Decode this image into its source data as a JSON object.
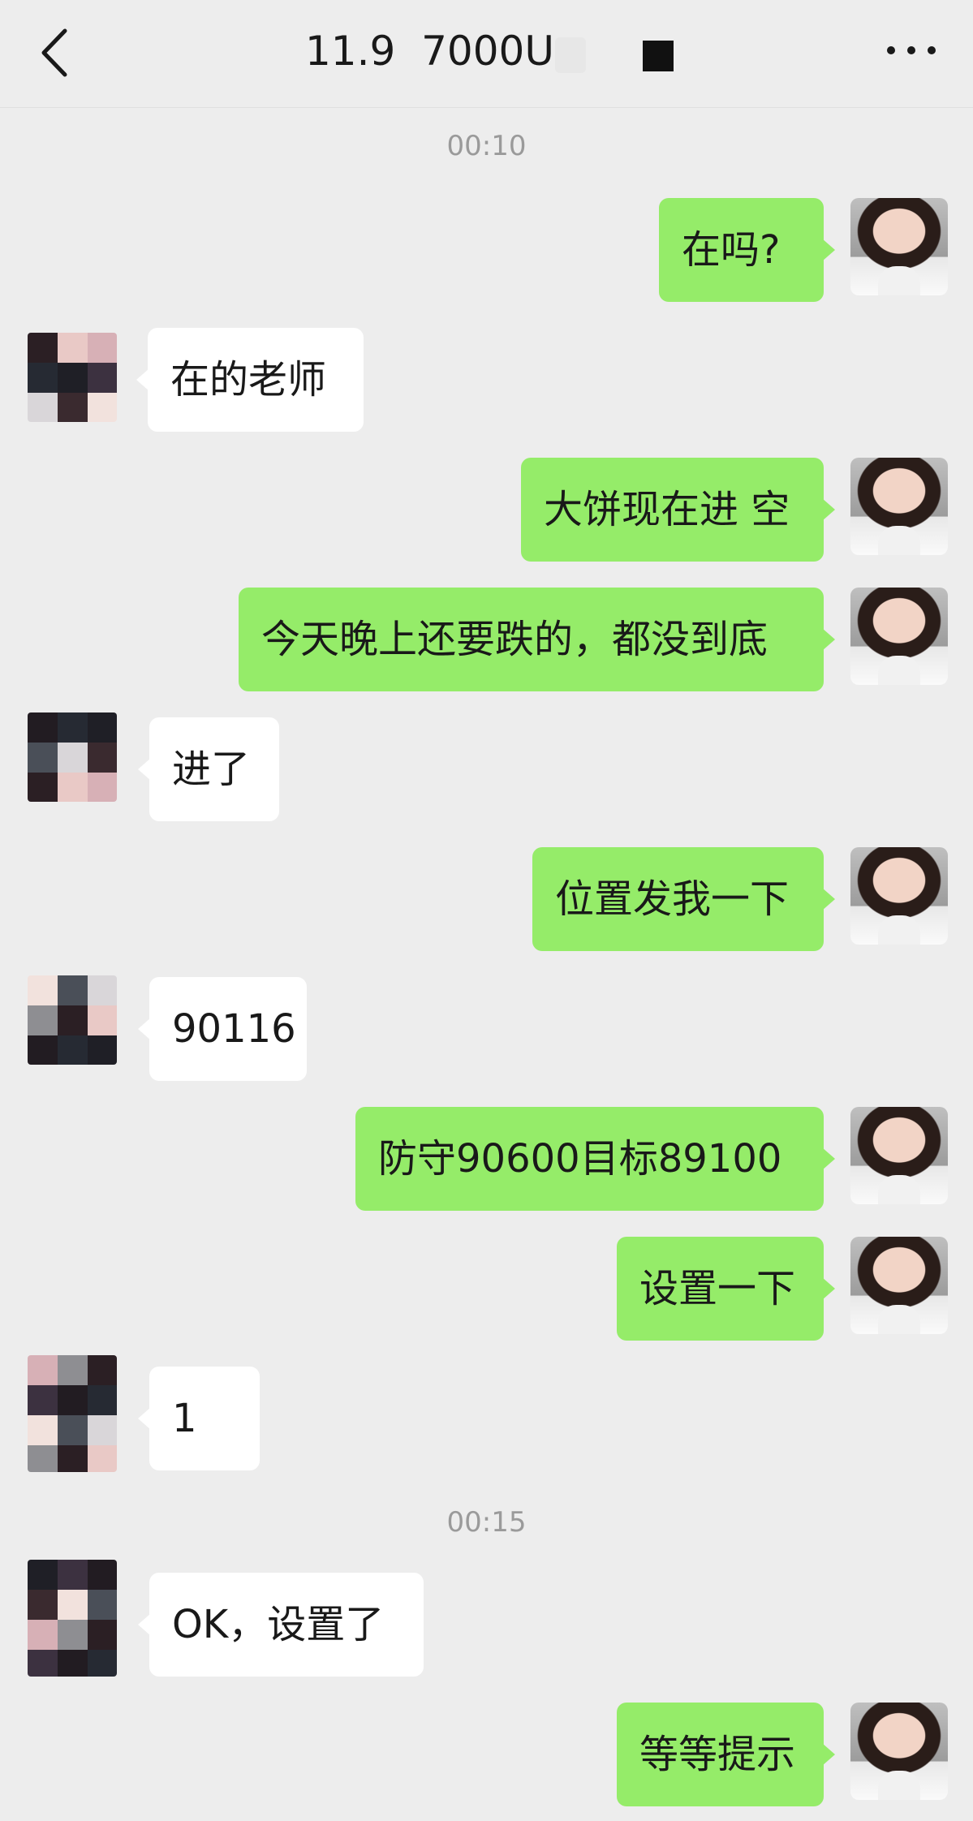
{
  "header": {
    "title": "11.9  7000U"
  },
  "timestamps": [
    "00:10",
    "00:15"
  ],
  "messages": [
    {
      "from": "me",
      "text": "在吗?"
    },
    {
      "from": "them",
      "text": "在的老师"
    },
    {
      "from": "me",
      "text": "大饼现在进 空"
    },
    {
      "from": "me",
      "text": "今天晚上还要跌的，都没到底"
    },
    {
      "from": "them",
      "text": "进了"
    },
    {
      "from": "me",
      "text": "位置发我一下"
    },
    {
      "from": "them",
      "text": "90116"
    },
    {
      "from": "me",
      "text": "防守90600目标89100"
    },
    {
      "from": "me",
      "text": "设置一下"
    },
    {
      "from": "them",
      "text": "1"
    },
    {
      "from": "them",
      "text": "OK，设置了"
    },
    {
      "from": "me",
      "text": "等等提示"
    }
  ],
  "colors": {
    "bg": "#ededed",
    "me_bubble": "#95ec69",
    "them_bubble": "#ffffff"
  }
}
